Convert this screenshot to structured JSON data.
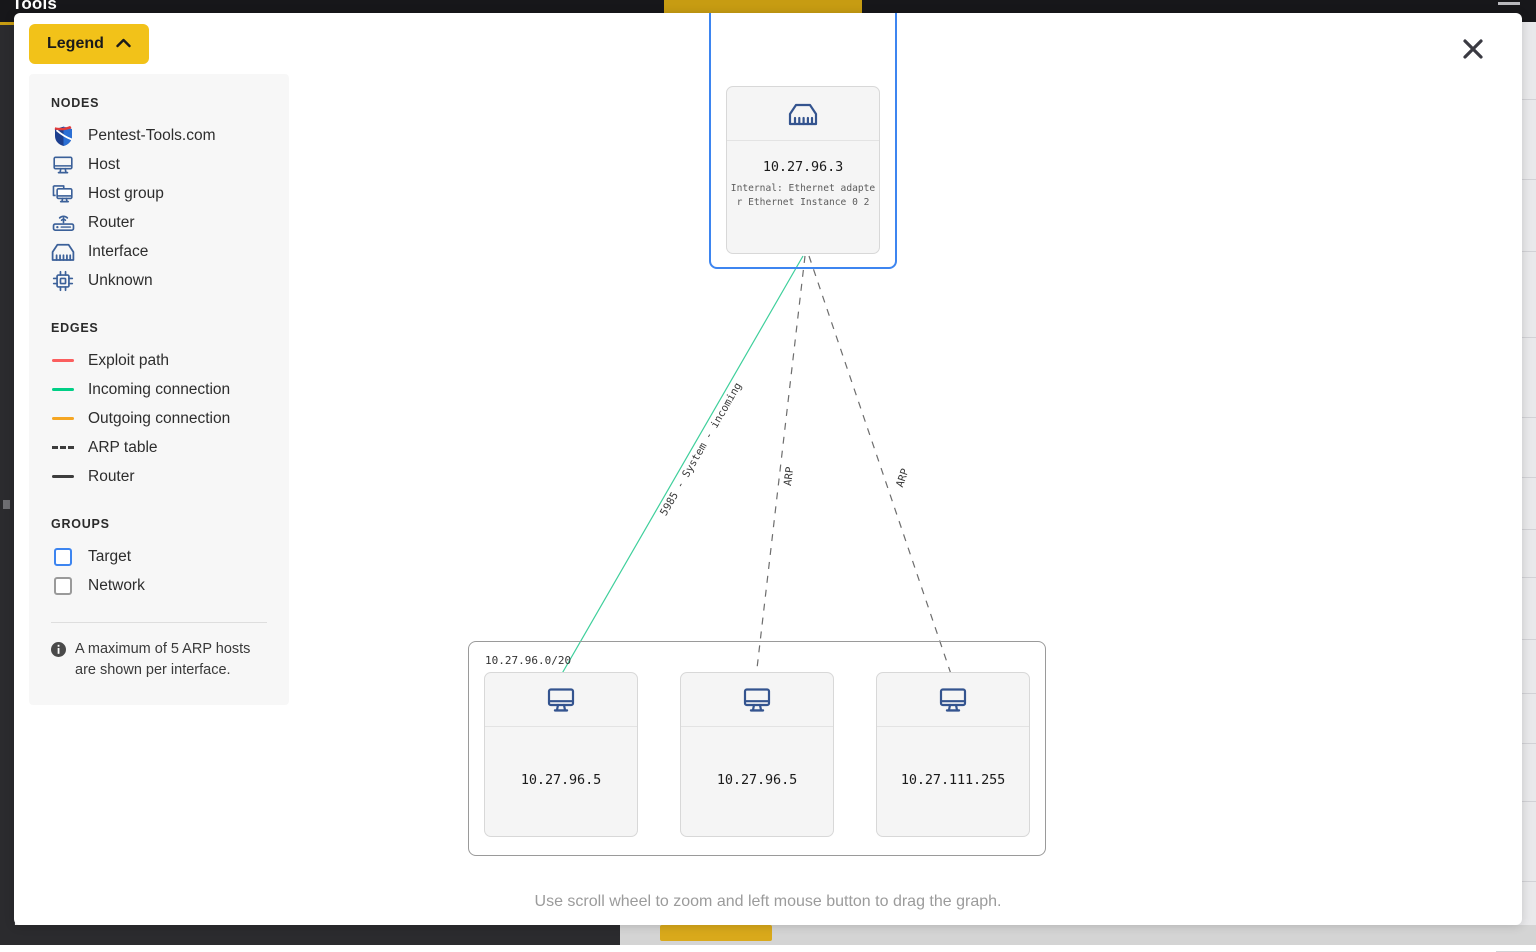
{
  "background": {
    "app_title": "Tools"
  },
  "modal": {
    "close_icon": "close-icon",
    "hint": "Use scroll wheel to zoom and left mouse button to drag the graph."
  },
  "legend": {
    "toggle_label": "Legend",
    "toggle_icon": "chevron-up-icon",
    "toggle_color": "#f2c219",
    "sections": {
      "nodes_heading": "NODES",
      "edges_heading": "EDGES",
      "groups_heading": "GROUPS"
    },
    "nodes": [
      {
        "label": "Pentest-Tools.com",
        "icon": "shield-logo-icon"
      },
      {
        "label": "Host",
        "icon": "monitor-icon"
      },
      {
        "label": "Host group",
        "icon": "monitor-stack-icon"
      },
      {
        "label": "Router",
        "icon": "router-icon"
      },
      {
        "label": "Interface",
        "icon": "ethernet-jack-icon"
      },
      {
        "label": "Unknown",
        "icon": "chip-icon"
      }
    ],
    "edges": [
      {
        "label": "Exploit path",
        "style": "solid",
        "color": "#fb5e5e"
      },
      {
        "label": "Incoming connection",
        "style": "solid",
        "color": "#00cf86"
      },
      {
        "label": "Outgoing connection",
        "style": "solid",
        "color": "#f5a623"
      },
      {
        "label": "ARP table",
        "style": "dashed",
        "color": "#3d3d3d"
      },
      {
        "label": "Router",
        "style": "solid",
        "color": "#3d3d3d"
      }
    ],
    "groups": [
      {
        "label": "Target",
        "color": "#3d85f0"
      },
      {
        "label": "Network",
        "color": "#9a9a9a"
      }
    ],
    "note": "A maximum of 5 ARP hosts are shown per interface.",
    "note_icon": "info-icon"
  },
  "graph": {
    "target_group": {
      "name": "Target",
      "border_color": "#3d85f0"
    },
    "network_group": {
      "name": "Network",
      "label": "10.27.96.0/20",
      "border_color": "#9a9a9a"
    },
    "nodes": [
      {
        "id": "iface",
        "type": "Interface",
        "icon": "ethernet-jack-icon",
        "title": "10.27.96.3",
        "subtitle": "Internal:\nEthernet adapter Ethernet Instance 0 2"
      },
      {
        "id": "host1",
        "type": "Host",
        "icon": "monitor-icon",
        "title": "10.27.96.5",
        "subtitle": ""
      },
      {
        "id": "host2",
        "type": "Host",
        "icon": "monitor-icon",
        "title": "10.27.96.5",
        "subtitle": ""
      },
      {
        "id": "host3",
        "type": "Host",
        "icon": "monitor-icon",
        "title": "10.27.111.255",
        "subtitle": ""
      }
    ],
    "edges": [
      {
        "from": "iface",
        "to": "host1",
        "label": "5985 - System - incoming",
        "style": "solid",
        "color": "#3ecf9b"
      },
      {
        "from": "iface",
        "to": "host2",
        "label": "ARP",
        "style": "dashed",
        "color": "#6d6d6d"
      },
      {
        "from": "iface",
        "to": "host3",
        "label": "ARP",
        "style": "dashed",
        "color": "#6d6d6d"
      }
    ]
  }
}
